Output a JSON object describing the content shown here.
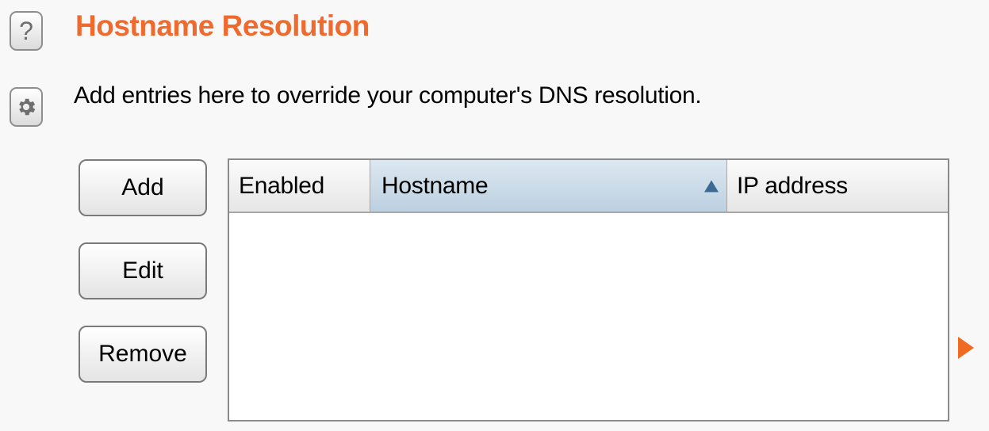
{
  "panel": {
    "title": "Hostname Resolution",
    "description": "Add entries here to override your computer's DNS resolution.",
    "help_icon": "question-mark-icon",
    "help_glyph": "?",
    "settings_icon": "gear-icon"
  },
  "buttons": {
    "add": "Add",
    "edit": "Edit",
    "remove": "Remove"
  },
  "table": {
    "columns": [
      {
        "label": "Enabled"
      },
      {
        "label": "Hostname",
        "sorted": "ascending"
      },
      {
        "label": "IP address"
      }
    ],
    "rows": []
  },
  "colors": {
    "title": "#ee6a2e",
    "accent_arrow": "#f06a22",
    "sorted_header": "#bcd0e0"
  },
  "icons": {
    "sort": "sort-ascending-icon",
    "expand": "expand-arrow-icon"
  }
}
